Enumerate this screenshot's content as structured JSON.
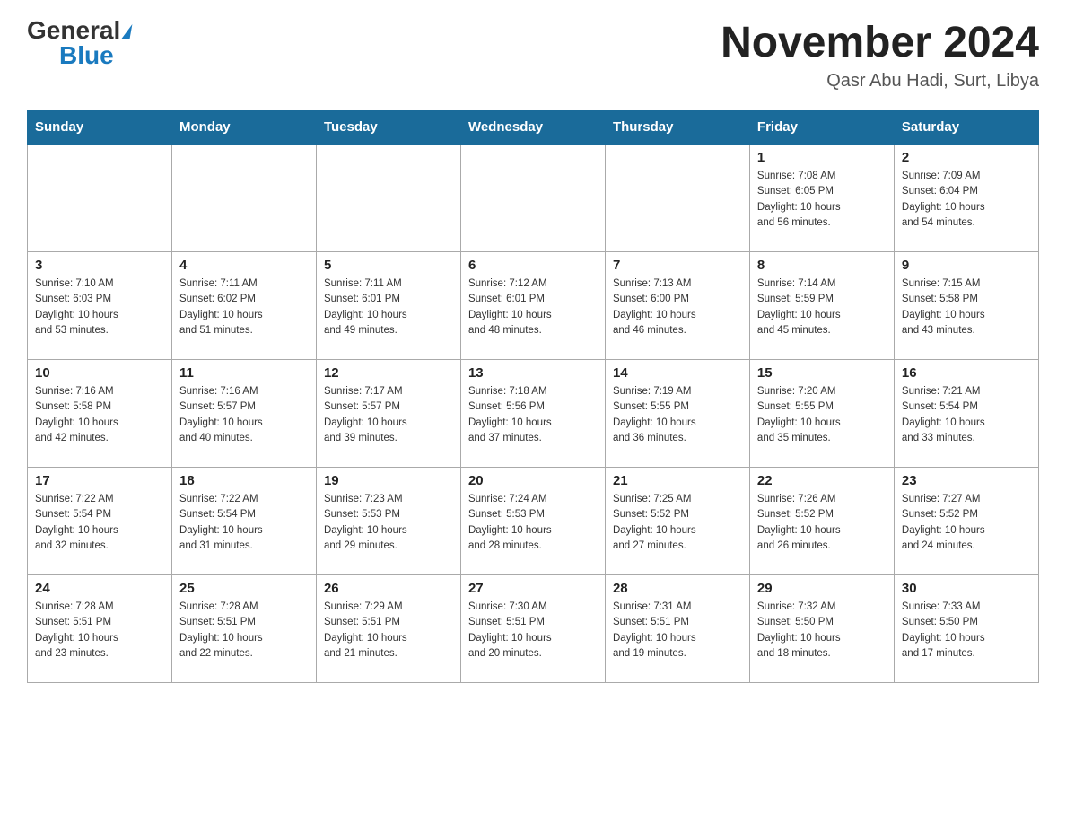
{
  "logo": {
    "general": "General",
    "blue": "Blue"
  },
  "title": "November 2024",
  "subtitle": "Qasr Abu Hadi, Surt, Libya",
  "days_of_week": [
    "Sunday",
    "Monday",
    "Tuesday",
    "Wednesday",
    "Thursday",
    "Friday",
    "Saturday"
  ],
  "weeks": [
    [
      {
        "day": "",
        "info": ""
      },
      {
        "day": "",
        "info": ""
      },
      {
        "day": "",
        "info": ""
      },
      {
        "day": "",
        "info": ""
      },
      {
        "day": "",
        "info": ""
      },
      {
        "day": "1",
        "info": "Sunrise: 7:08 AM\nSunset: 6:05 PM\nDaylight: 10 hours\nand 56 minutes."
      },
      {
        "day": "2",
        "info": "Sunrise: 7:09 AM\nSunset: 6:04 PM\nDaylight: 10 hours\nand 54 minutes."
      }
    ],
    [
      {
        "day": "3",
        "info": "Sunrise: 7:10 AM\nSunset: 6:03 PM\nDaylight: 10 hours\nand 53 minutes."
      },
      {
        "day": "4",
        "info": "Sunrise: 7:11 AM\nSunset: 6:02 PM\nDaylight: 10 hours\nand 51 minutes."
      },
      {
        "day": "5",
        "info": "Sunrise: 7:11 AM\nSunset: 6:01 PM\nDaylight: 10 hours\nand 49 minutes."
      },
      {
        "day": "6",
        "info": "Sunrise: 7:12 AM\nSunset: 6:01 PM\nDaylight: 10 hours\nand 48 minutes."
      },
      {
        "day": "7",
        "info": "Sunrise: 7:13 AM\nSunset: 6:00 PM\nDaylight: 10 hours\nand 46 minutes."
      },
      {
        "day": "8",
        "info": "Sunrise: 7:14 AM\nSunset: 5:59 PM\nDaylight: 10 hours\nand 45 minutes."
      },
      {
        "day": "9",
        "info": "Sunrise: 7:15 AM\nSunset: 5:58 PM\nDaylight: 10 hours\nand 43 minutes."
      }
    ],
    [
      {
        "day": "10",
        "info": "Sunrise: 7:16 AM\nSunset: 5:58 PM\nDaylight: 10 hours\nand 42 minutes."
      },
      {
        "day": "11",
        "info": "Sunrise: 7:16 AM\nSunset: 5:57 PM\nDaylight: 10 hours\nand 40 minutes."
      },
      {
        "day": "12",
        "info": "Sunrise: 7:17 AM\nSunset: 5:57 PM\nDaylight: 10 hours\nand 39 minutes."
      },
      {
        "day": "13",
        "info": "Sunrise: 7:18 AM\nSunset: 5:56 PM\nDaylight: 10 hours\nand 37 minutes."
      },
      {
        "day": "14",
        "info": "Sunrise: 7:19 AM\nSunset: 5:55 PM\nDaylight: 10 hours\nand 36 minutes."
      },
      {
        "day": "15",
        "info": "Sunrise: 7:20 AM\nSunset: 5:55 PM\nDaylight: 10 hours\nand 35 minutes."
      },
      {
        "day": "16",
        "info": "Sunrise: 7:21 AM\nSunset: 5:54 PM\nDaylight: 10 hours\nand 33 minutes."
      }
    ],
    [
      {
        "day": "17",
        "info": "Sunrise: 7:22 AM\nSunset: 5:54 PM\nDaylight: 10 hours\nand 32 minutes."
      },
      {
        "day": "18",
        "info": "Sunrise: 7:22 AM\nSunset: 5:54 PM\nDaylight: 10 hours\nand 31 minutes."
      },
      {
        "day": "19",
        "info": "Sunrise: 7:23 AM\nSunset: 5:53 PM\nDaylight: 10 hours\nand 29 minutes."
      },
      {
        "day": "20",
        "info": "Sunrise: 7:24 AM\nSunset: 5:53 PM\nDaylight: 10 hours\nand 28 minutes."
      },
      {
        "day": "21",
        "info": "Sunrise: 7:25 AM\nSunset: 5:52 PM\nDaylight: 10 hours\nand 27 minutes."
      },
      {
        "day": "22",
        "info": "Sunrise: 7:26 AM\nSunset: 5:52 PM\nDaylight: 10 hours\nand 26 minutes."
      },
      {
        "day": "23",
        "info": "Sunrise: 7:27 AM\nSunset: 5:52 PM\nDaylight: 10 hours\nand 24 minutes."
      }
    ],
    [
      {
        "day": "24",
        "info": "Sunrise: 7:28 AM\nSunset: 5:51 PM\nDaylight: 10 hours\nand 23 minutes."
      },
      {
        "day": "25",
        "info": "Sunrise: 7:28 AM\nSunset: 5:51 PM\nDaylight: 10 hours\nand 22 minutes."
      },
      {
        "day": "26",
        "info": "Sunrise: 7:29 AM\nSunset: 5:51 PM\nDaylight: 10 hours\nand 21 minutes."
      },
      {
        "day": "27",
        "info": "Sunrise: 7:30 AM\nSunset: 5:51 PM\nDaylight: 10 hours\nand 20 minutes."
      },
      {
        "day": "28",
        "info": "Sunrise: 7:31 AM\nSunset: 5:51 PM\nDaylight: 10 hours\nand 19 minutes."
      },
      {
        "day": "29",
        "info": "Sunrise: 7:32 AM\nSunset: 5:50 PM\nDaylight: 10 hours\nand 18 minutes."
      },
      {
        "day": "30",
        "info": "Sunrise: 7:33 AM\nSunset: 5:50 PM\nDaylight: 10 hours\nand 17 minutes."
      }
    ]
  ]
}
